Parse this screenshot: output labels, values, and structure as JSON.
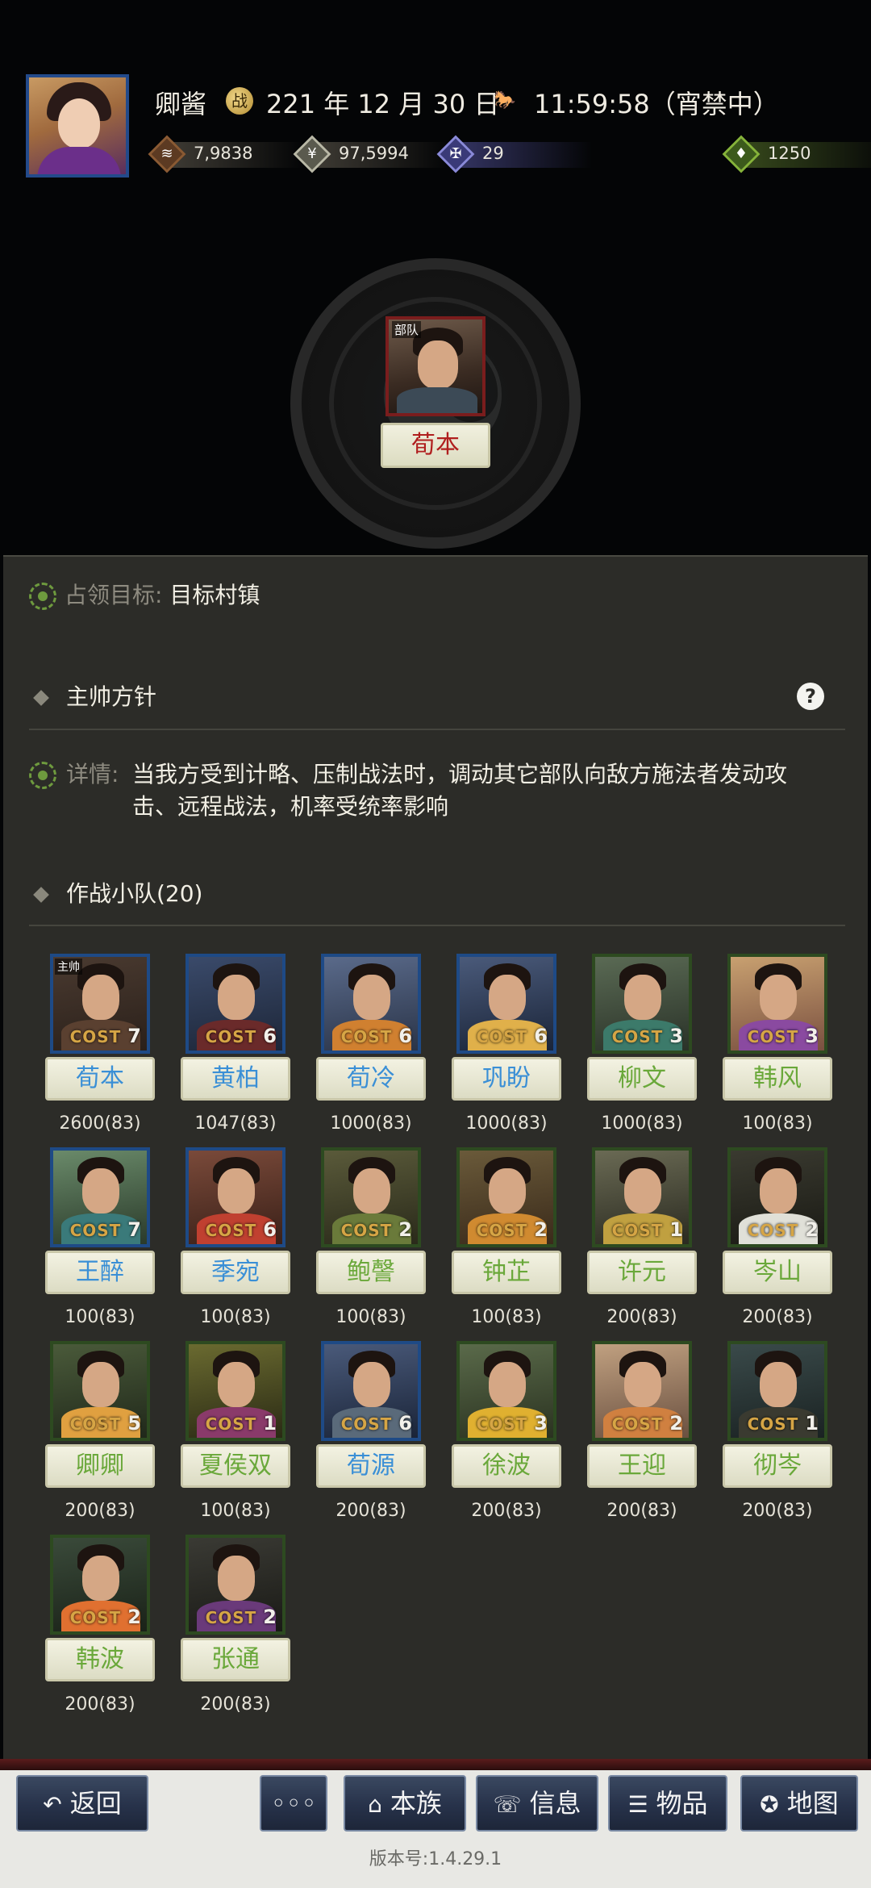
{
  "header": {
    "player_name": "卿酱",
    "date_icon_glyph": "战",
    "date": "221 年 12 月 30 日",
    "time_icon_glyph": "🐎",
    "time": "11:59:58（宵禁中）",
    "resources": {
      "copper": "7,9838",
      "food": "97,5994",
      "military": "29",
      "jade": "1250"
    }
  },
  "team": {
    "leader_tag": "部队",
    "leader_name": "荀本"
  },
  "panel": {
    "target_label": "占领目标:",
    "target_value": "目标村镇",
    "policy_title": "主帅方针",
    "help_glyph": "?",
    "detail_label": "详情:",
    "detail_text": "当我方受到计略、压制战法时，调动其它部队向敌方施法者发动攻击、远程战法，机率受统率影响",
    "squad_title": "作战小队(20)"
  },
  "squad": [
    {
      "name": "荀本",
      "cost": "7",
      "power": "2600(83)",
      "tag": "主帅",
      "frame": "blue"
    },
    {
      "name": "黄柏",
      "cost": "6",
      "power": "1047(83)",
      "tag": "",
      "frame": "blue"
    },
    {
      "name": "荀冷",
      "cost": "6",
      "power": "1000(83)",
      "tag": "",
      "frame": "blue"
    },
    {
      "name": "巩盼",
      "cost": "6",
      "power": "1000(83)",
      "tag": "",
      "frame": "blue"
    },
    {
      "name": "柳文",
      "cost": "3",
      "power": "1000(83)",
      "tag": "",
      "frame": "green"
    },
    {
      "name": "韩风",
      "cost": "3",
      "power": "100(83)",
      "tag": "",
      "frame": "green"
    },
    {
      "name": "王醉",
      "cost": "7",
      "power": "100(83)",
      "tag": "",
      "frame": "blue"
    },
    {
      "name": "季宛",
      "cost": "6",
      "power": "100(83)",
      "tag": "",
      "frame": "blue"
    },
    {
      "name": "鲍謦",
      "cost": "2",
      "power": "100(83)",
      "tag": "",
      "frame": "green"
    },
    {
      "name": "钟芷",
      "cost": "2",
      "power": "100(83)",
      "tag": "",
      "frame": "green"
    },
    {
      "name": "许元",
      "cost": "1",
      "power": "200(83)",
      "tag": "",
      "frame": "green"
    },
    {
      "name": "岑山",
      "cost": "2",
      "power": "200(83)",
      "tag": "",
      "frame": "green"
    },
    {
      "name": "卿卿",
      "cost": "5",
      "power": "200(83)",
      "tag": "",
      "frame": "green"
    },
    {
      "name": "夏侯双",
      "cost": "1",
      "power": "100(83)",
      "tag": "",
      "frame": "green"
    },
    {
      "name": "荀源",
      "cost": "6",
      "power": "200(83)",
      "tag": "",
      "frame": "blue"
    },
    {
      "name": "徐波",
      "cost": "3",
      "power": "200(83)",
      "tag": "",
      "frame": "green"
    },
    {
      "name": "王迎",
      "cost": "2",
      "power": "200(83)",
      "tag": "",
      "frame": "green"
    },
    {
      "name": "彻岑",
      "cost": "1",
      "power": "200(83)",
      "tag": "",
      "frame": "green"
    },
    {
      "name": "韩波",
      "cost": "2",
      "power": "200(83)",
      "tag": "",
      "frame": "green"
    },
    {
      "name": "张通",
      "cost": "2",
      "power": "200(83)",
      "tag": "",
      "frame": "green"
    }
  ],
  "cost_prefix": "COST",
  "bottom_bar": {
    "back": "返回",
    "more": "◦◦◦",
    "clan": "本族",
    "info": "信息",
    "items": "物品",
    "map": "地图",
    "version": "版本号:1.4.29.1"
  },
  "colors": {
    "frame_blue": "#1e4a86",
    "frame_green": "#2d4a20",
    "name_green": "#6aa83a",
    "leader_red": "#b01e1e"
  }
}
